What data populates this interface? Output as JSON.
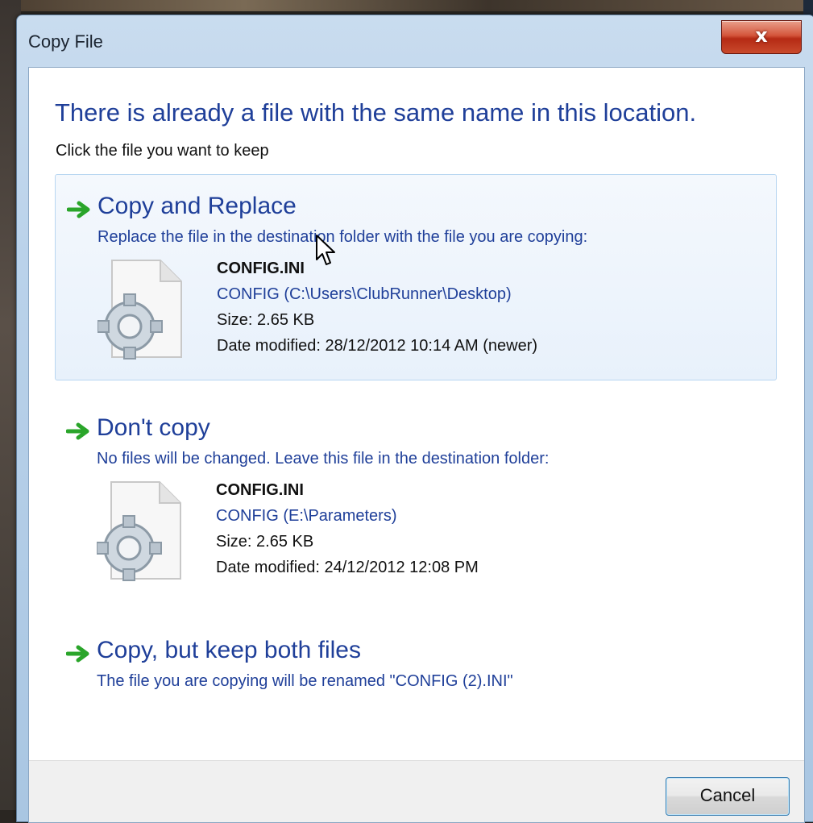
{
  "window": {
    "title": "Copy File",
    "close_label": "x"
  },
  "dialog": {
    "headline": "There is already a file with the same name in this location.",
    "subline": "Click the file you want to keep"
  },
  "options": [
    {
      "title": "Copy and Replace",
      "description": "Replace the file in the destination folder with the file you are copying:",
      "selected": true,
      "file": {
        "name": "CONFIG.INI",
        "location": "CONFIG (C:\\Users\\ClubRunner\\Desktop)",
        "size": "Size: 2.65 KB",
        "modified": "Date modified: 28/12/2012 10:14 AM (newer)"
      }
    },
    {
      "title": "Don't copy",
      "description": "No files will be changed. Leave this file in the destination folder:",
      "selected": false,
      "file": {
        "name": "CONFIG.INI",
        "location": "CONFIG (E:\\Parameters)",
        "size": "Size: 2.65 KB",
        "modified": "Date modified: 24/12/2012 12:08 PM"
      }
    },
    {
      "title": "Copy, but keep both files",
      "description": "The file you are copying will be renamed \"CONFIG (2).INI\"",
      "selected": false
    }
  ],
  "footer": {
    "cancel_label": "Cancel"
  },
  "icons": {
    "arrow": "green-arrow-icon",
    "file": "config-file-gear-icon",
    "cursor": "mouse-pointer-icon"
  },
  "colors": {
    "headline": "#1f3f99",
    "arrow": "#2aa52a",
    "close_button": "#c94a2c"
  }
}
